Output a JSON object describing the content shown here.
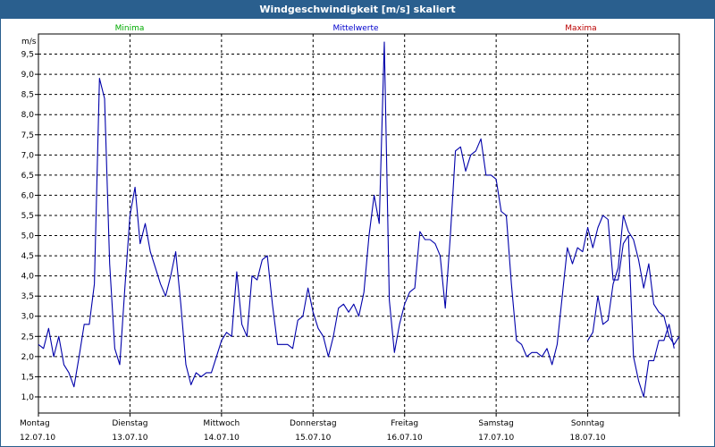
{
  "window": {
    "title": "Windgeschwindigkeit [m/s] skaliert"
  },
  "legend": [
    {
      "label": "Minima",
      "color": "#00aa00"
    },
    {
      "label": "Mittelwerte",
      "color": "#0000cc"
    },
    {
      "label": "Maxima",
      "color": "#bb0000"
    }
  ],
  "colors": {
    "series": "#0000aa",
    "grid": "#000000",
    "title_bar": "#2a5f8e"
  },
  "chart_data": {
    "type": "line",
    "ylabel": "m/s",
    "ylim": [
      0.6,
      10.0
    ],
    "yticks": [
      "1,0",
      "1,5",
      "2,0",
      "2,5",
      "3,0",
      "3,5",
      "4,0",
      "4,5",
      "5,0",
      "5,5",
      "6,0",
      "6,5",
      "7,0",
      "7,5",
      "8,0",
      "8,5",
      "9,0",
      "9,5"
    ],
    "ytick_values": [
      1.0,
      1.5,
      2.0,
      2.5,
      3.0,
      3.5,
      4.0,
      4.5,
      5.0,
      5.5,
      6.0,
      6.5,
      7.0,
      7.5,
      8.0,
      8.5,
      9.0,
      9.5
    ],
    "xlim": [
      "2010-07-12 00:00",
      "2010-07-19 00:00"
    ],
    "x_labels": [
      {
        "day": "Montag",
        "date": "12.07.10"
      },
      {
        "day": "Dienstag",
        "date": "13.07.10"
      },
      {
        "day": "Mittwoch",
        "date": "14.07.10"
      },
      {
        "day": "Donnerstag",
        "date": "15.07.10"
      },
      {
        "day": "Freitag",
        "date": "16.07.10"
      },
      {
        "day": "Samstag",
        "date": "17.07.10"
      },
      {
        "day": "Sonntag",
        "date": "18.07.10"
      }
    ],
    "grid": true,
    "legend_placement": "top",
    "series": [
      {
        "name": "Mittelwerte",
        "points": [
          [
            "2010-07-12 00:00",
            2.3
          ],
          [
            "2010-07-12 01:20",
            2.2
          ],
          [
            "2010-07-12 02:40",
            2.7
          ],
          [
            "2010-07-12 04:00",
            2.0
          ],
          [
            "2010-07-12 05:20",
            2.5
          ],
          [
            "2010-07-12 06:40",
            1.8
          ],
          [
            "2010-07-12 08:00",
            1.6
          ],
          [
            "2010-07-12 09:20",
            1.25
          ],
          [
            "2010-07-12 10:40",
            2.0
          ],
          [
            "2010-07-12 12:00",
            2.8
          ],
          [
            "2010-07-12 13:20",
            2.8
          ],
          [
            "2010-07-12 14:40",
            3.8
          ],
          [
            "2010-07-12 16:00",
            8.9
          ],
          [
            "2010-07-12 17:20",
            8.4
          ],
          [
            "2010-07-12 18:40",
            4.3
          ],
          [
            "2010-07-12 20:00",
            2.2
          ],
          [
            "2010-07-12 21:20",
            1.8
          ],
          [
            "2010-07-12 22:40",
            3.7
          ],
          [
            "2010-07-13 00:00",
            5.5
          ],
          [
            "2010-07-13 01:20",
            6.2
          ],
          [
            "2010-07-13 02:40",
            4.8
          ],
          [
            "2010-07-13 04:00",
            5.3
          ],
          [
            "2010-07-13 05:20",
            4.6
          ],
          [
            "2010-07-13 06:40",
            4.2
          ],
          [
            "2010-07-13 08:00",
            3.8
          ],
          [
            "2010-07-13 09:20",
            3.5
          ],
          [
            "2010-07-13 10:40",
            4.0
          ],
          [
            "2010-07-13 12:00",
            4.6
          ],
          [
            "2010-07-13 13:20",
            3.3
          ],
          [
            "2010-07-13 14:40",
            1.8
          ],
          [
            "2010-07-13 16:00",
            1.3
          ],
          [
            "2010-07-13 17:20",
            1.6
          ],
          [
            "2010-07-13 18:40",
            1.5
          ],
          [
            "2010-07-13 20:00",
            1.6
          ],
          [
            "2010-07-13 21:20",
            1.6
          ],
          [
            "2010-07-13 22:40",
            2.0
          ],
          [
            "2010-07-14 00:00",
            2.4
          ],
          [
            "2010-07-14 01:20",
            2.6
          ],
          [
            "2010-07-14 02:40",
            2.5
          ],
          [
            "2010-07-14 04:00",
            4.1
          ],
          [
            "2010-07-14 05:20",
            2.8
          ],
          [
            "2010-07-14 06:40",
            2.5
          ],
          [
            "2010-07-14 08:00",
            4.0
          ],
          [
            "2010-07-14 09:20",
            3.9
          ],
          [
            "2010-07-14 10:40",
            4.4
          ],
          [
            "2010-07-14 12:00",
            4.5
          ],
          [
            "2010-07-14 13:20",
            3.3
          ],
          [
            "2010-07-14 14:40",
            2.3
          ],
          [
            "2010-07-14 16:00",
            2.3
          ],
          [
            "2010-07-14 17:20",
            2.3
          ],
          [
            "2010-07-14 18:40",
            2.2
          ],
          [
            "2010-07-14 20:00",
            2.9
          ],
          [
            "2010-07-14 21:20",
            3.0
          ],
          [
            "2010-07-14 22:40",
            3.7
          ],
          [
            "2010-07-15 00:00",
            3.1
          ],
          [
            "2010-07-15 01:20",
            2.7
          ],
          [
            "2010-07-15 02:40",
            2.5
          ],
          [
            "2010-07-15 04:00",
            2.0
          ],
          [
            "2010-07-15 05:20",
            2.5
          ],
          [
            "2010-07-15 06:40",
            3.2
          ],
          [
            "2010-07-15 08:00",
            3.3
          ],
          [
            "2010-07-15 09:20",
            3.1
          ],
          [
            "2010-07-15 10:40",
            3.3
          ],
          [
            "2010-07-15 12:00",
            3.0
          ],
          [
            "2010-07-15 13:20",
            3.6
          ],
          [
            "2010-07-15 14:40",
            5.0
          ],
          [
            "2010-07-15 16:00",
            6.0
          ],
          [
            "2010-07-15 17:20",
            5.3
          ],
          [
            "2010-07-15 18:40",
            9.8
          ],
          [
            "2010-07-15 20:00",
            3.4
          ],
          [
            "2010-07-15 21:20",
            2.1
          ],
          [
            "2010-07-15 22:40",
            2.8
          ],
          [
            "2010-07-16 00:00",
            3.3
          ],
          [
            "2010-07-16 01:20",
            3.6
          ],
          [
            "2010-07-16 02:40",
            3.7
          ],
          [
            "2010-07-16 04:00",
            5.1
          ],
          [
            "2010-07-16 05:20",
            4.9
          ],
          [
            "2010-07-16 06:40",
            4.9
          ],
          [
            "2010-07-16 08:00",
            4.8
          ],
          [
            "2010-07-16 09:20",
            4.5
          ],
          [
            "2010-07-16 10:40",
            3.2
          ],
          [
            "2010-07-16 12:00",
            5.0
          ],
          [
            "2010-07-16 13:20",
            7.1
          ],
          [
            "2010-07-16 14:40",
            7.2
          ],
          [
            "2010-07-16 16:00",
            6.6
          ],
          [
            "2010-07-16 17:20",
            7.0
          ],
          [
            "2010-07-16 18:40",
            7.1
          ],
          [
            "2010-07-16 20:00",
            7.4
          ],
          [
            "2010-07-16 21:20",
            6.5
          ],
          [
            "2010-07-16 22:40",
            6.5
          ],
          [
            "2010-07-17 00:00",
            6.4
          ],
          [
            "2010-07-17 01:20",
            5.6
          ],
          [
            "2010-07-17 02:40",
            5.5
          ],
          [
            "2010-07-17 04:00",
            3.8
          ],
          [
            "2010-07-17 05:20",
            2.4
          ],
          [
            "2010-07-17 06:40",
            2.3
          ],
          [
            "2010-07-17 08:00",
            2.0
          ],
          [
            "2010-07-17 09:20",
            2.1
          ],
          [
            "2010-07-17 10:40",
            2.1
          ],
          [
            "2010-07-17 12:00",
            2.0
          ],
          [
            "2010-07-17 13:20",
            2.2
          ],
          [
            "2010-07-17 14:40",
            1.8
          ],
          [
            "2010-07-17 16:00",
            2.3
          ],
          [
            "2010-07-17 17:20",
            3.5
          ],
          [
            "2010-07-17 18:40",
            4.7
          ],
          [
            "2010-07-17 20:00",
            4.3
          ],
          [
            "2010-07-17 21:20",
            4.7
          ],
          [
            "2010-07-17 22:40",
            4.6
          ],
          [
            "2010-07-18 00:00",
            5.2
          ],
          [
            "2010-07-18 01:20",
            4.7
          ],
          [
            "2010-07-18 02:40",
            5.2
          ],
          [
            "2010-07-18 04:00",
            5.5
          ],
          [
            "2010-07-18 05:20",
            5.4
          ],
          [
            "2010-07-18 06:40",
            3.9
          ],
          [
            "2010-07-18 08:00",
            3.9
          ],
          [
            "2010-07-18 09:20",
            4.8
          ],
          [
            "2010-07-18 10:40",
            5.0
          ],
          [
            "2010-07-18 12:00",
            2.0
          ],
          [
            "2010-07-18 13:20",
            1.4
          ],
          [
            "2010-07-18 14:40",
            1.0
          ],
          [
            "2010-07-18 16:00",
            1.9
          ],
          [
            "2010-07-18 17:20",
            1.9
          ],
          [
            "2010-07-18 18:40",
            2.4
          ],
          [
            "2010-07-18 20:00",
            2.4
          ],
          [
            "2010-07-18 21:20",
            2.8
          ],
          [
            "2010-07-18 22:40",
            2.2
          ]
        ]
      },
      {
        "name": "Mittelwerte",
        "points": [
          [
            "2010-07-18 00:00",
            2.4
          ],
          [
            "2010-07-18 01:20",
            2.6
          ],
          [
            "2010-07-18 02:40",
            3.5
          ],
          [
            "2010-07-18 04:00",
            2.8
          ],
          [
            "2010-07-18 05:20",
            2.9
          ],
          [
            "2010-07-18 06:40",
            3.8
          ],
          [
            "2010-07-18 08:00",
            4.2
          ],
          [
            "2010-07-18 09:20",
            5.5
          ],
          [
            "2010-07-18 10:40",
            5.1
          ],
          [
            "2010-07-18 12:00",
            4.9
          ],
          [
            "2010-07-18 13:20",
            4.4
          ],
          [
            "2010-07-18 14:40",
            3.7
          ],
          [
            "2010-07-18 16:00",
            4.3
          ],
          [
            "2010-07-18 17:20",
            3.3
          ],
          [
            "2010-07-18 18:40",
            3.1
          ],
          [
            "2010-07-18 20:00",
            3.0
          ],
          [
            "2010-07-18 21:20",
            2.5
          ],
          [
            "2010-07-18 22:40",
            2.3
          ],
          [
            "2010-07-19 00:00",
            2.5
          ]
        ]
      }
    ]
  }
}
